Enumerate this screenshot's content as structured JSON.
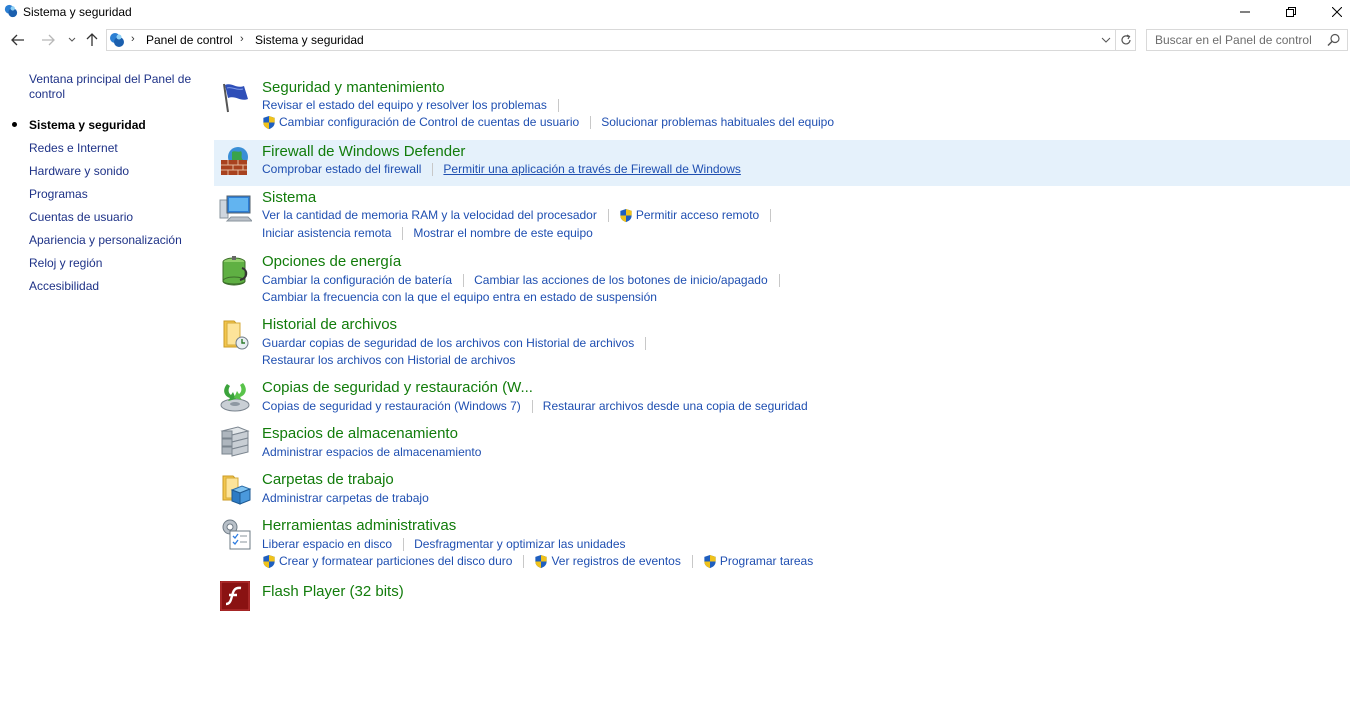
{
  "window": {
    "title": "Sistema y seguridad",
    "controls": [
      "minimize-icon",
      "restore-icon",
      "close-icon"
    ]
  },
  "navigation": {
    "breadcrumb": [
      "Panel de control",
      "Sistema y seguridad"
    ],
    "search_placeholder": "Buscar en el Panel de control"
  },
  "sidebar": {
    "home": "Ventana principal del Panel de control",
    "items": [
      {
        "label": "Sistema y seguridad",
        "current": true
      },
      {
        "label": "Redes e Internet"
      },
      {
        "label": "Hardware y sonido"
      },
      {
        "label": "Programas"
      },
      {
        "label": "Cuentas de usuario"
      },
      {
        "label": "Apariencia y personalización"
      },
      {
        "label": "Reloj y región"
      },
      {
        "label": "Accesibilidad"
      }
    ]
  },
  "categories": {
    "security": {
      "title": "Seguridad y mantenimiento",
      "links": [
        "Revisar el estado del equipo y resolver los problemas",
        "Cambiar configuración de Control de cuentas de usuario",
        "Solucionar problemas habituales del equipo"
      ]
    },
    "firewall": {
      "title": "Firewall de Windows Defender",
      "links": [
        "Comprobar estado del firewall",
        "Permitir una aplicación a través de Firewall de Windows"
      ]
    },
    "system": {
      "title": "Sistema",
      "links": [
        "Ver la cantidad de memoria RAM y la velocidad del procesador",
        "Permitir acceso remoto",
        "Iniciar asistencia remota",
        "Mostrar el nombre de este equipo"
      ]
    },
    "power": {
      "title": "Opciones de energía",
      "links": [
        "Cambiar la configuración de batería",
        "Cambiar las acciones de los botones de inicio/apagado",
        "Cambiar la frecuencia con la que el equipo entra en estado de suspensión"
      ]
    },
    "history": {
      "title": "Historial de archivos",
      "links": [
        "Guardar copias de seguridad de los archivos con Historial de archivos",
        "Restaurar los archivos con Historial de archivos"
      ]
    },
    "backup": {
      "title": "Copias de seguridad y restauración (W...",
      "links": [
        "Copias de seguridad y restauración (Windows 7)",
        "Restaurar archivos desde una copia de seguridad"
      ]
    },
    "storage": {
      "title": "Espacios de almacenamiento",
      "links": [
        "Administrar espacios de almacenamiento"
      ]
    },
    "workfolders": {
      "title": "Carpetas de trabajo",
      "links": [
        "Administrar carpetas de trabajo"
      ]
    },
    "admin": {
      "title": "Herramientas administrativas",
      "links": [
        "Liberar espacio en disco",
        "Desfragmentar y optimizar las unidades",
        "Crear y formatear particiones del disco duro",
        "Ver registros de eventos",
        "Programar tareas"
      ]
    },
    "flash": {
      "title": "Flash Player (32 bits)"
    }
  },
  "colors": {
    "category_title": "#127c0b",
    "link": "#1f4fb1",
    "sidebar_link": "#1e3287",
    "highlight": "#e5f1fb"
  }
}
